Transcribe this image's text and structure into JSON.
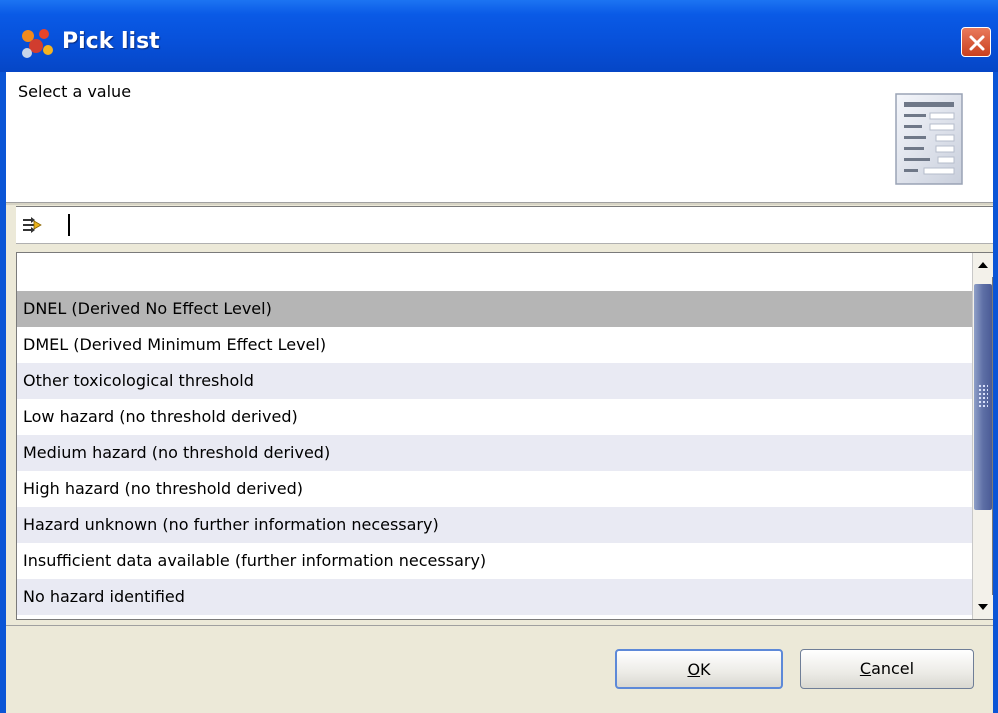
{
  "window": {
    "title": "Pick list",
    "close_icon": "close-icon"
  },
  "header": {
    "prompt": "Select a value",
    "icon": "list-document-icon"
  },
  "filter": {
    "icon": "filter-arrows-icon",
    "value": "",
    "placeholder": ""
  },
  "list": {
    "selected_index": 1,
    "items": [
      {
        "label": ""
      },
      {
        "label": "DNEL (Derived No Effect Level)"
      },
      {
        "label": "DMEL (Derived Minimum Effect Level)"
      },
      {
        "label": "Other toxicological threshold"
      },
      {
        "label": "Low hazard (no threshold derived)"
      },
      {
        "label": "Medium hazard (no threshold derived)"
      },
      {
        "label": "High hazard (no threshold derived)"
      },
      {
        "label": "Hazard unknown (no further information necessary)"
      },
      {
        "label": "Insufficient data available (further information necessary)"
      },
      {
        "label": "No hazard identified"
      }
    ]
  },
  "buttons": {
    "ok_mnemonic": "O",
    "ok_rest": "K",
    "cancel_mnemonic": "C",
    "cancel_rest": "ancel"
  },
  "colors": {
    "titlebar": "#0750d9",
    "selected_row": "#b5b5b5",
    "alt_row": "#e9eaf3",
    "scroll_thumb": "#5e6fa6"
  }
}
